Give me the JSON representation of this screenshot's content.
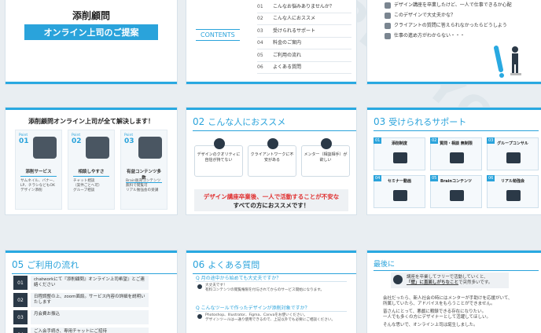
{
  "s1": {
    "title1": "添削顧問",
    "title2": "オンライン上司のご提案"
  },
  "toc": {
    "label": "CONTENTS",
    "items": [
      {
        "num": "01",
        "text": "こんなお悩みありませんか？"
      },
      {
        "num": "02",
        "text": "こんな人におススメ"
      },
      {
        "num": "03",
        "text": "受けられるサポート"
      },
      {
        "num": "04",
        "text": "料金のご案内"
      },
      {
        "num": "05",
        "text": "ご利用の流れ"
      },
      {
        "num": "06",
        "text": "よくある質問"
      }
    ]
  },
  "worries": {
    "items": [
      "デザイン講座を卒業したけど、一人で仕事できるか心配",
      "このデザインで大丈夫かな？",
      "クライアントの質問に答えられなかったらどうしよう",
      "仕事の進め方がわからない・・・"
    ]
  },
  "s4": {
    "title": "添削顧問オンライン上司が全て解決します！",
    "points": [
      {
        "label": "Point",
        "num": "01",
        "head": "添削サービス",
        "desc": "サムネイル、バナー、LP、チラシなどもOK\nデザイン添削"
      },
      {
        "label": "Point",
        "num": "02",
        "head": "相談しやすさ",
        "desc": "チャット相談\n（案件ごとへ可）\nグループ相談"
      },
      {
        "label": "Point",
        "num": "03",
        "head": "有益コンテンツ多数",
        "desc": "Brain販売コンテンツ\n無料で閲覧可\nリアル勉強会の受講"
      }
    ]
  },
  "s5": {
    "num": "02",
    "title": "こんな人におススメ",
    "persons": [
      "デザインのクオリティに自信が持てない",
      "クライアントワークに不安がある",
      "メンター（相談相手）が欲しい"
    ],
    "banner_hl": "デザイン講座卒業後、一人で活動することが不安な",
    "banner_rest": "すべての方におススメです！"
  },
  "s6": {
    "num": "03",
    "title": "受けられるサポート",
    "cards": [
      {
        "num": "01",
        "head": "添削制度"
      },
      {
        "num": "02",
        "head": "質問・相談 無制限"
      },
      {
        "num": "03",
        "head": "グループコンサル"
      },
      {
        "num": "04",
        "head": "セミナー動画"
      },
      {
        "num": "05",
        "head": "Brainコンテンツ"
      },
      {
        "num": "06",
        "head": "リアル勉強会"
      }
    ]
  },
  "s7": {
    "num": "05",
    "title": "ご利用の流れ",
    "steps": [
      {
        "num": "01",
        "text": "chatworkにて『添削顧問』オンライン上司希望』とご連絡ください"
      },
      {
        "num": "02",
        "text": "日程調整の上、zoom面談。サービス内容の詳細を説明いたします"
      },
      {
        "num": "03",
        "text": "月会費お振込"
      },
      {
        "num": "04",
        "text": "ご入会手続き、専用チャットにご招待"
      }
    ]
  },
  "s8": {
    "num": "06",
    "title": "よくある質問",
    "qas": [
      {
        "q": "Q  月の途中から始めても大丈夫ですか？",
        "a": "大丈夫です！\n有料コンテンツの閲覧権限を付与されてからのサービス開始になります。"
      },
      {
        "q": "Q  こんなツールで作ったデザインが添削対象ですか？",
        "a": "Photoshop、Illustrator、Figma、Canvaをお使いください。\nデザインツールは一通り使用できるので、上記以外でも必要にご相談ください。"
      }
    ]
  },
  "s9": {
    "title": "最後に",
    "quote1": "講座を卒業してフリーで活動していくと、",
    "quote2": "「壁」に直面しがちなこと",
    "quote3": "で突然多いです。",
    "p1": "会社だったら、新人社会の時にはメンターが手助けを応援がいて、",
    "p2": "所属していたら、アドバイスをもらうことができません。",
    "p3": "皆さんにとって、悪戯に頼録できる存在になりたい。",
    "p4": "一人でも多くの方にデザイナーとして活躍してほしい。",
    "p5": "そんな思いで、オンライン上司は誕生しました。"
  }
}
